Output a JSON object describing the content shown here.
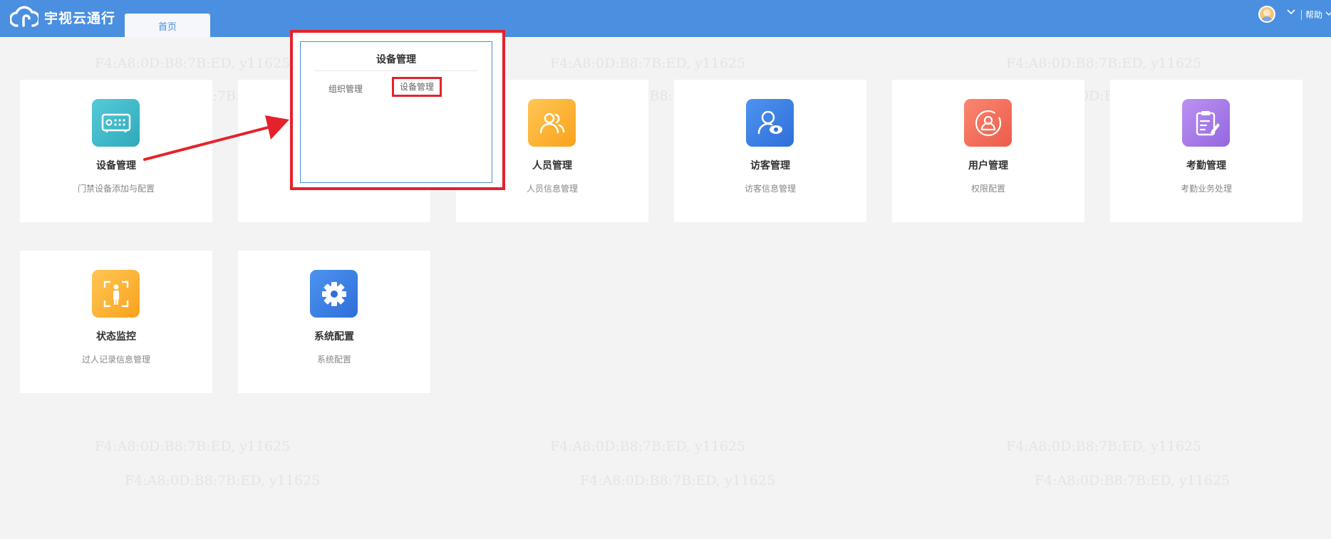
{
  "header": {
    "app_name": "宇视云通行",
    "tab_home": "首页",
    "help_label": "帮助"
  },
  "watermark_text": "F4:A8:0D:B8:7B:ED, y11625",
  "cards": [
    {
      "title": "设备管理",
      "subtitle": "门禁设备添加与配置",
      "icon": "device-icon",
      "color": "#3cb8c8"
    },
    {
      "title": "",
      "subtitle": "",
      "icon": "organization-icon",
      "color": "#4a8fe0"
    },
    {
      "title": "人员管理",
      "subtitle": "人员信息管理",
      "icon": "people-icon",
      "color": "#fbb034"
    },
    {
      "title": "访客管理",
      "subtitle": "访客信息管理",
      "icon": "visitor-icon",
      "color": "#3d7ee6"
    },
    {
      "title": "用户管理",
      "subtitle": "权限配置",
      "icon": "user-icon",
      "color": "#f26b5b"
    },
    {
      "title": "考勤管理",
      "subtitle": "考勤业务处理",
      "icon": "attendance-icon",
      "color": "#a979e8"
    },
    {
      "title": "状态监控",
      "subtitle": "过人记录信息管理",
      "icon": "monitor-icon",
      "color": "#fbb034"
    },
    {
      "title": "系统配置",
      "subtitle": "系统配置",
      "icon": "gear-icon",
      "color": "#3d7ee6"
    }
  ],
  "popup": {
    "title": "设备管理",
    "items": [
      "组织管理",
      "设备管理"
    ]
  }
}
